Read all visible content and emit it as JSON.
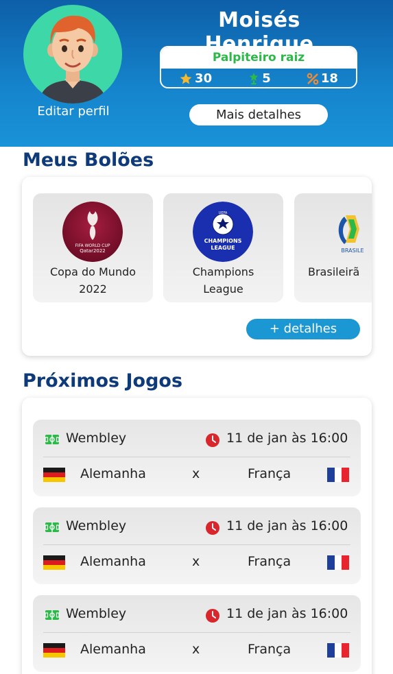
{
  "profile": {
    "name": "Moisés Henrique",
    "edit_label": "Editar perfil",
    "rank_title": "Palpiteiro raiz",
    "stats": {
      "stars": "30",
      "trophies": "5",
      "percent": "18"
    },
    "details_label": "Mais detalhes"
  },
  "pools": {
    "title": "Meus Bolões",
    "items": [
      {
        "name_line1": "Copa do Mundo",
        "name_line2": "2022",
        "logo": "fifa-world-cup-qatar-2022-logo",
        "logo_text_1": "FIFA WORLD CUP",
        "logo_text_2": "Qatar2022"
      },
      {
        "name_line1": "Champions",
        "name_line2": "League",
        "logo": "uefa-champions-league-logo",
        "logo_text_1": "UEFA",
        "logo_text_2": "CHAMPIONS",
        "logo_text_3": "LEAGUE"
      },
      {
        "name_line1": "Brasileirã",
        "name_line2": "",
        "logo": "brasileirao-logo",
        "logo_text_1": "BRASILE"
      }
    ],
    "more_label": "+ detalhes"
  },
  "games": {
    "title": "Próximos Jogos",
    "items": [
      {
        "stadium": "Wembley",
        "datetime": "11 de jan às 16:00",
        "home": "Alemanha",
        "vs": "x",
        "away": "França"
      },
      {
        "stadium": "Wembley",
        "datetime": "11 de jan às 16:00",
        "home": "Alemanha",
        "vs": "x",
        "away": "França"
      },
      {
        "stadium": "Wembley",
        "datetime": "11 de jan às 16:00",
        "home": "Alemanha",
        "vs": "x",
        "away": "França"
      }
    ]
  },
  "colors": {
    "header_blue": "#0d5fa8",
    "avatar_bg": "#3ed7a8",
    "rank_green": "#2db84a",
    "star_gold": "#f5b82e",
    "percent_orange": "#f08a34",
    "section_title": "#0e3a7a",
    "button_blue": "#1b98d4",
    "clock_red": "#d9262c",
    "stadium_green": "#2db84a"
  },
  "icons": [
    "avatar",
    "star-icon",
    "trophy-icon",
    "percent-icon",
    "stadium-icon",
    "clock-icon",
    "germany-flag",
    "france-flag"
  ]
}
